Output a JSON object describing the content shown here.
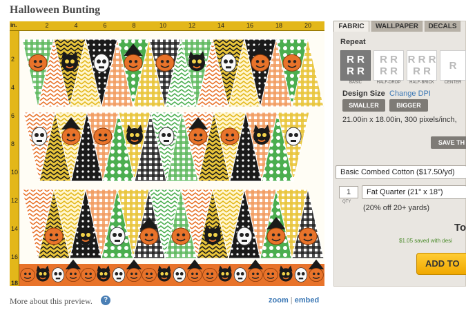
{
  "page": {
    "title": "Halloween Bunting"
  },
  "ruler": {
    "unit": "in.",
    "top_ticks": [
      "2",
      "4",
      "6",
      "8",
      "10",
      "12",
      "14",
      "16",
      "18",
      "20"
    ],
    "left_ticks": [
      "2",
      "4",
      "6",
      "8",
      "10",
      "12",
      "14",
      "16",
      "18"
    ]
  },
  "preview_footer": {
    "more_about": "More about this preview.",
    "help_icon_glyph": "?",
    "zoom_label": "zoom",
    "separator": "|",
    "embed_label": "embed"
  },
  "tabs": [
    {
      "label": "FABRIC",
      "active": true
    },
    {
      "label": "WALLPAPER",
      "active": false
    },
    {
      "label": "DECALS",
      "active": false
    }
  ],
  "repeat": {
    "heading": "Repeat",
    "options": [
      {
        "label": "BASIC",
        "active": true
      },
      {
        "label": "HALF-DROP",
        "active": false
      },
      {
        "label": "HALF-BRICK",
        "active": false
      },
      {
        "label": "CENTER",
        "active": false
      }
    ]
  },
  "design_size": {
    "heading": "Design Size",
    "change_dpi_link": "Change DPI",
    "smaller_button": "SMALLER",
    "bigger_button": "BIGGER",
    "size_text": "21.00in x 18.00in, 300 pixels/inch,",
    "save_button": "SAVE TH"
  },
  "fabric_select": {
    "value": "Basic Combed Cotton ($17.50/yd)"
  },
  "quantity": {
    "value": "1",
    "label": "QTY"
  },
  "size_select": {
    "value": "Fat Quarter (21\" x 18\")"
  },
  "pricing": {
    "discount_note": "(20% off 20+ yards)",
    "total_label": "To",
    "saved_text": "$1.05 saved with desi",
    "add_button": "ADD TO"
  },
  "colors": {
    "ruler": "#e3b71a",
    "orange": "#e8732a",
    "green": "#4bae4f",
    "yellow": "#e9c53a",
    "black": "#1a1a1a",
    "cream": "#fffdf5",
    "link": "#3c78b5",
    "button_gold": "#f0a800"
  },
  "icons": {
    "help": "question-mark-circle-icon"
  }
}
